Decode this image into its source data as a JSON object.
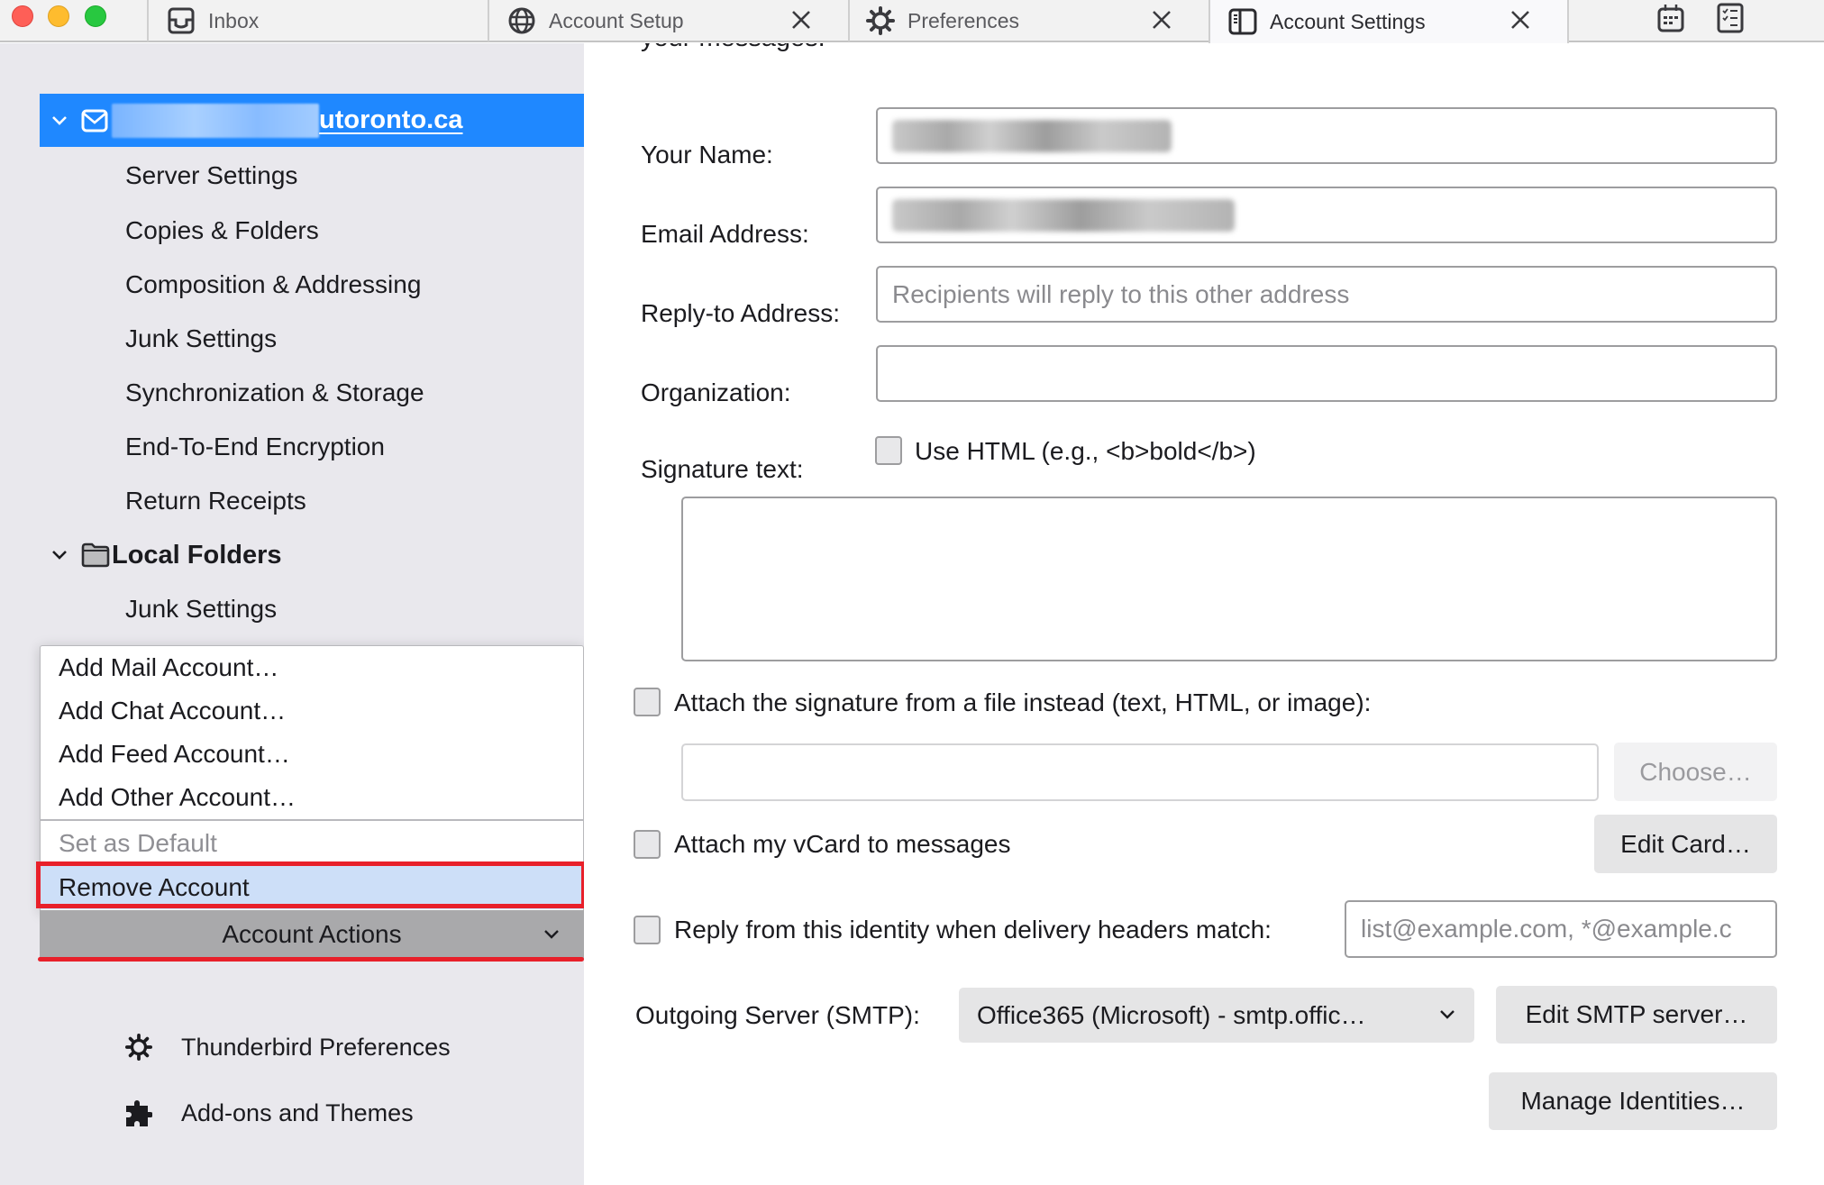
{
  "window": {
    "tabs": [
      {
        "label": "Inbox",
        "icon": "inbox-icon",
        "closable": false,
        "active": false
      },
      {
        "label": "Account Setup",
        "icon": "globe-icon",
        "closable": true,
        "active": false
      },
      {
        "label": "Preferences",
        "icon": "gear-icon",
        "closable": true,
        "active": false
      },
      {
        "label": "Account Settings",
        "icon": "account-settings-icon",
        "closable": true,
        "active": true
      }
    ],
    "toolbar_icons": [
      "calendar-icon",
      "tasks-icon"
    ]
  },
  "sidebar": {
    "account": {
      "domain_suffix": "utoronto.ca",
      "icon": "mail-icon",
      "expanded": true
    },
    "account_items": [
      {
        "label": "Server Settings"
      },
      {
        "label": "Copies & Folders"
      },
      {
        "label": "Composition & Addressing"
      },
      {
        "label": "Junk Settings"
      },
      {
        "label": "Synchronization & Storage"
      },
      {
        "label": "End-To-End Encryption"
      },
      {
        "label": "Return Receipts"
      }
    ],
    "local_folders": {
      "label": "Local Folders",
      "icon": "folder-icon",
      "expanded": true,
      "items": [
        {
          "label": "Junk Settings"
        }
      ]
    },
    "account_actions_menu": {
      "items": [
        {
          "label": "Add Mail Account…",
          "disabled": false
        },
        {
          "label": "Add Chat Account…",
          "disabled": false
        },
        {
          "label": "Add Feed Account…",
          "disabled": false
        },
        {
          "label": "Add Other Account…",
          "disabled": false
        },
        {
          "label": "Set as Default",
          "disabled": true
        },
        {
          "label": "Remove Account",
          "disabled": false,
          "highlighted": true
        }
      ]
    },
    "account_actions_button": {
      "label": "Account Actions"
    },
    "bottom_links": [
      {
        "label": "Thunderbird Preferences",
        "icon": "gear-icon"
      },
      {
        "label": "Add-ons and Themes",
        "icon": "puzzle-piece-icon"
      }
    ],
    "annotation_color": "#e8202a",
    "selection_color": "#1f88ff"
  },
  "form": {
    "cut_off_text": "your messages.",
    "your_name": {
      "label": "Your Name:",
      "value_redacted": true
    },
    "email_address": {
      "label": "Email Address:",
      "value_redacted": true
    },
    "reply_to": {
      "label": "Reply-to Address:",
      "placeholder": "Recipients will reply to this other address",
      "value": ""
    },
    "organization": {
      "label": "Organization:",
      "value": ""
    },
    "signature": {
      "label": "Signature text:",
      "use_html_label": "Use HTML (e.g., <b>bold</b>)",
      "use_html_checked": false,
      "text": ""
    },
    "attach_signature": {
      "label": "Attach the signature from a file instead (text, HTML, or image):",
      "checked": false,
      "file_path": "",
      "choose_label": "Choose…"
    },
    "vcard": {
      "label": "Attach my vCard to messages",
      "checked": false,
      "edit_label": "Edit Card…"
    },
    "reply_from_identity": {
      "label": "Reply from this identity when delivery headers match:",
      "checked": false,
      "placeholder": "list@example.com, *@example.c"
    },
    "smtp": {
      "label": "Outgoing Server (SMTP):",
      "selected": "Office365 (Microsoft) - smtp.offic…",
      "edit_label": "Edit SMTP server…"
    },
    "manage_identities_label": "Manage Identities…"
  }
}
